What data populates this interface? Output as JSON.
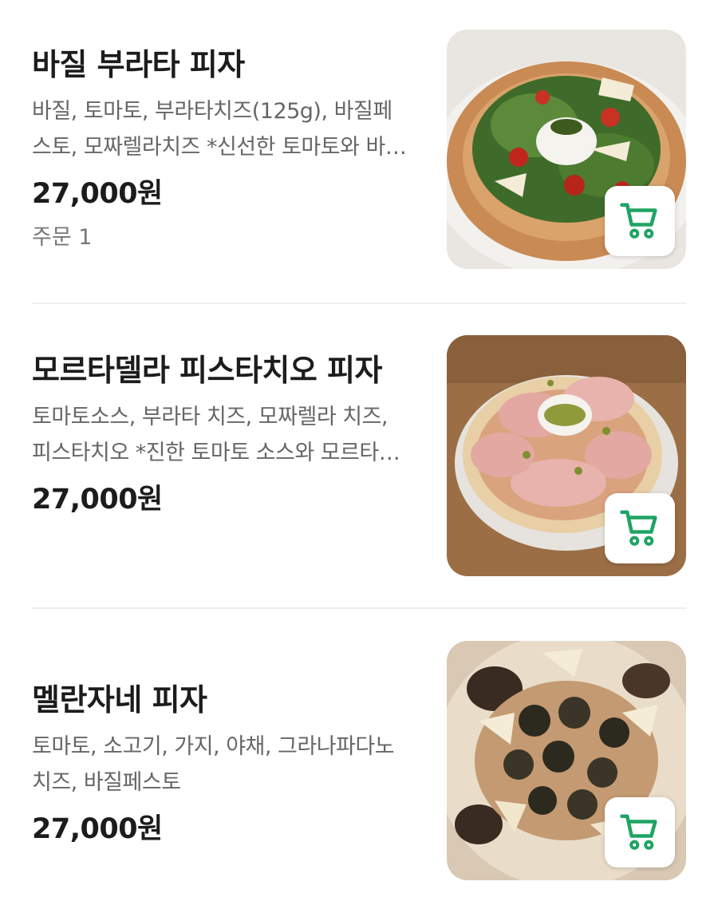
{
  "colors": {
    "accent_green": "#1fa463",
    "divider": "#eeeeee",
    "text_primary": "#1c1c1c",
    "text_secondary": "#666666"
  },
  "menu": {
    "items": [
      {
        "name": "바질 부라타 피자",
        "description": "바질, 토마토, 부라타치즈(125g), 바질페스토, 모짜렐라치즈 *신선한 토마토와 바질이 어우러진 피자",
        "price": "27,000원",
        "orders": "주문 1",
        "image_icon": "basil-burrata-pizza-photo",
        "cart_icon": "cart-icon"
      },
      {
        "name": "모르타델라 피스타치오 피자",
        "description": "토마토소스, 부라타 치즈, 모짜렐라 치즈,피스타치오 *진한 토마토 소스와 모르타델라의 풍미",
        "price": "27,000원",
        "image_icon": "mortadella-pistachio-pizza-photo",
        "cart_icon": "cart-icon"
      },
      {
        "name": "멜란자네 피자",
        "description": "토마토, 소고기, 가지, 야채, 그라나파다노치즈, 바질페스토",
        "price": "27,000원",
        "image_icon": "melanzane-pizza-photo",
        "cart_icon": "cart-icon"
      }
    ]
  }
}
